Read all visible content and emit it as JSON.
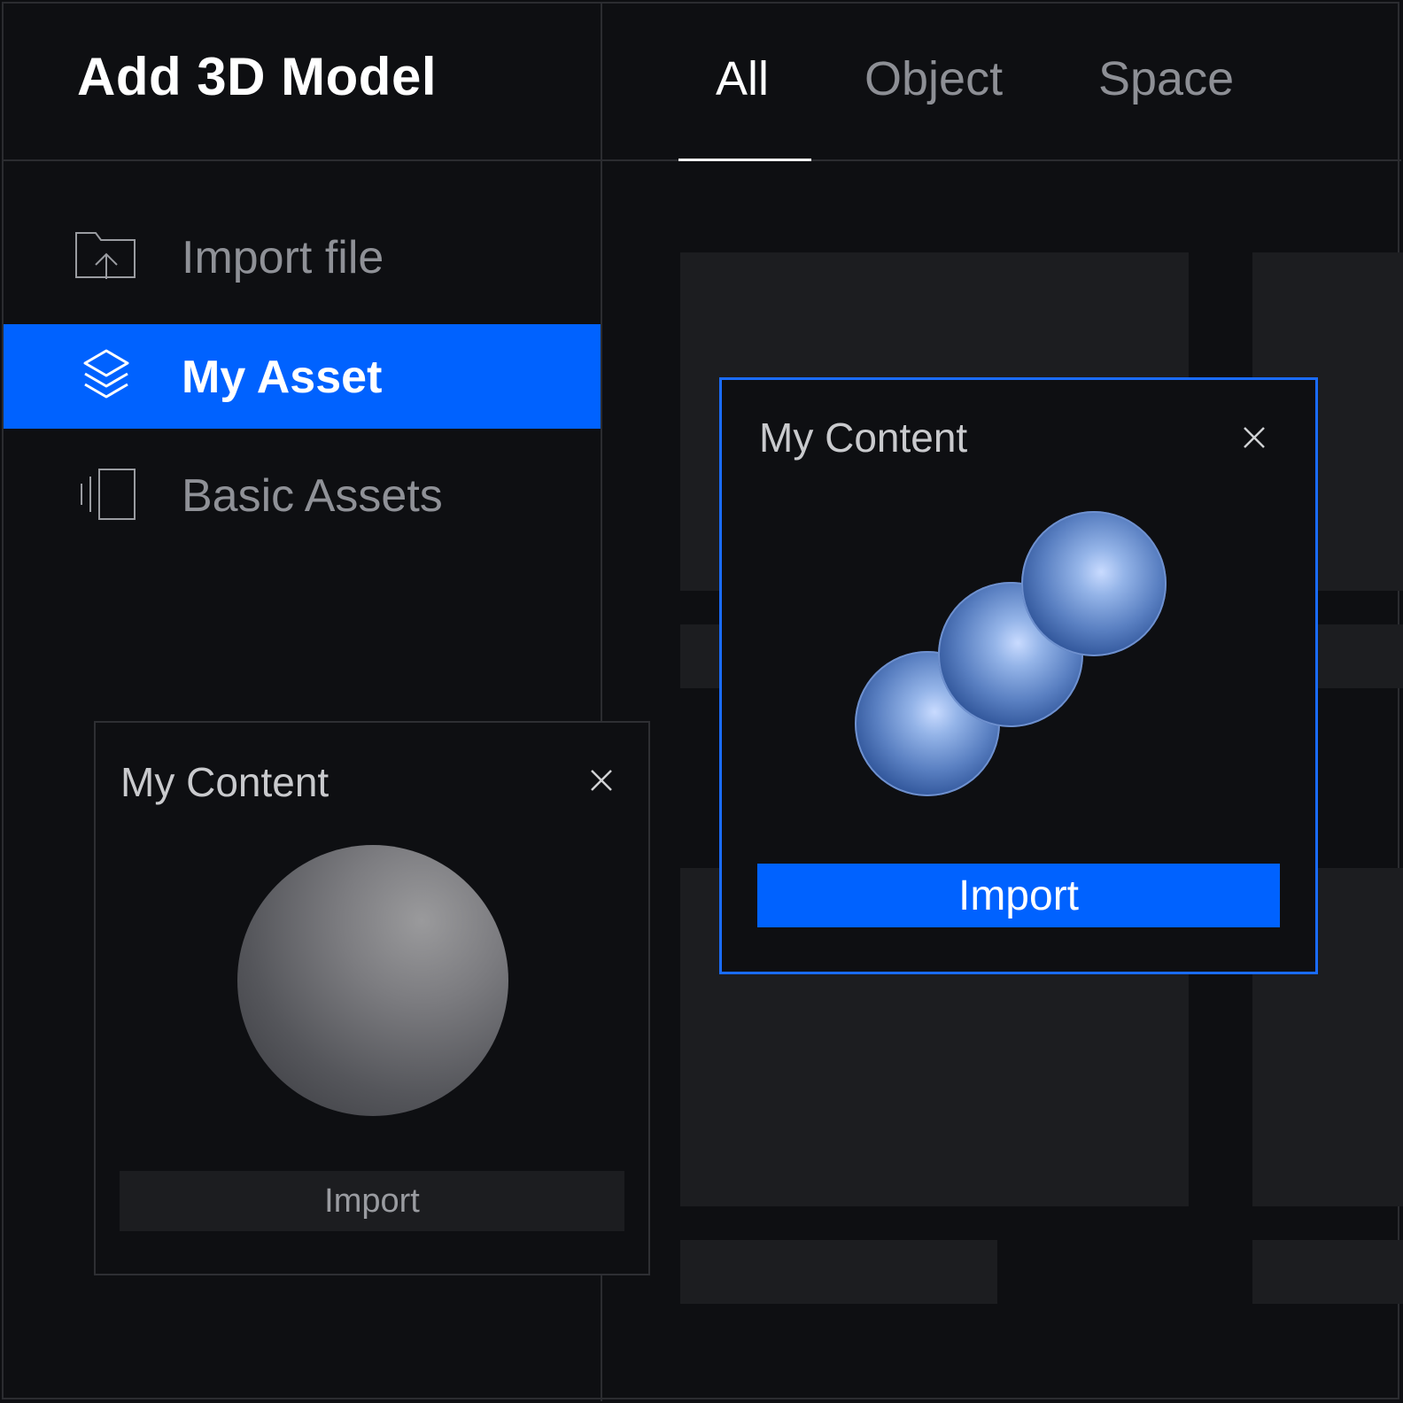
{
  "app": {
    "title": "Add 3D Model"
  },
  "tabs": [
    {
      "label": "All",
      "active": true
    },
    {
      "label": "Object",
      "active": false
    },
    {
      "label": "Space",
      "active": false
    }
  ],
  "sidebar": {
    "items": [
      {
        "label": "Import file",
        "icon": "folder-upload-icon",
        "selected": false
      },
      {
        "label": "My Asset",
        "icon": "layers-icon",
        "selected": true
      },
      {
        "label": "Basic Assets",
        "icon": "stacked-cards-icon",
        "selected": false
      }
    ]
  },
  "cards": [
    {
      "title": "My Content",
      "import_label": "Import",
      "preview": "gray-sphere",
      "state": "default"
    },
    {
      "title": "My Content",
      "import_label": "Import",
      "preview": "three-blue-spheres",
      "state": "selected"
    }
  ],
  "colors": {
    "background": "#0e0f12",
    "accent": "#0062ff",
    "tile": "#1c1d20",
    "border": "#2b2c30"
  }
}
